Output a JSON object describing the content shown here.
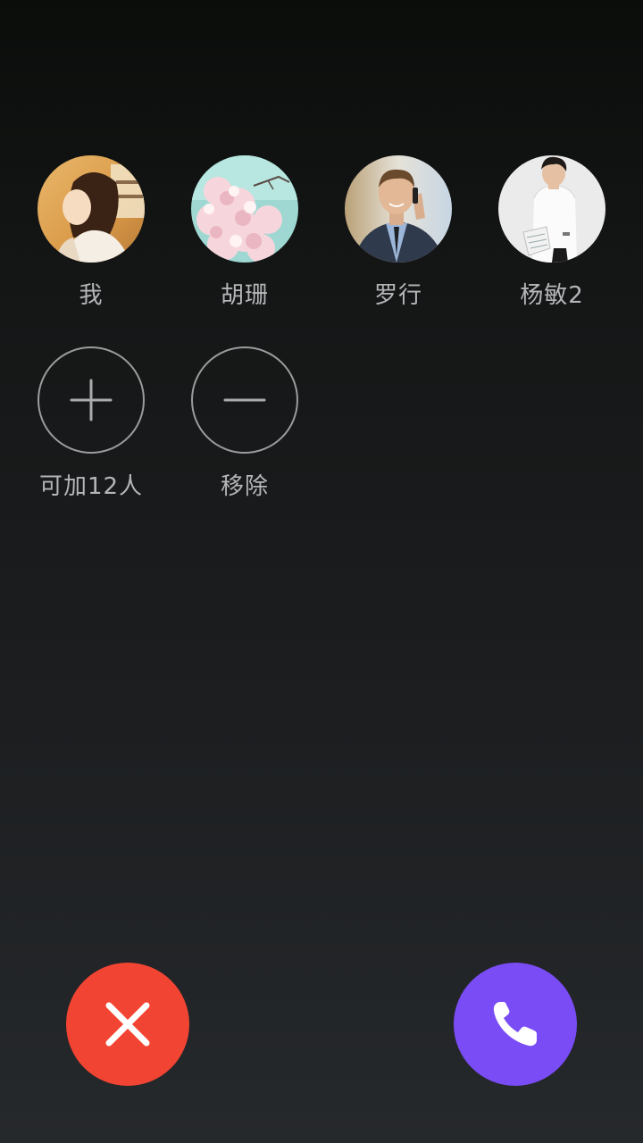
{
  "participants": [
    {
      "name": "我",
      "avatar": "girl-photo"
    },
    {
      "name": "胡珊",
      "avatar": "cherry-blossom-photo"
    },
    {
      "name": "罗行",
      "avatar": "businessman-phone-photo"
    },
    {
      "name": "杨敏2",
      "avatar": "businesswoman-photo"
    }
  ],
  "actions": {
    "add_label": "可加12人",
    "remove_label": "移除"
  },
  "call_controls": {
    "decline_icon": "close-icon",
    "accept_icon": "phone-icon",
    "decline_color": "#f24433",
    "accept_color": "#7a4cf5"
  }
}
